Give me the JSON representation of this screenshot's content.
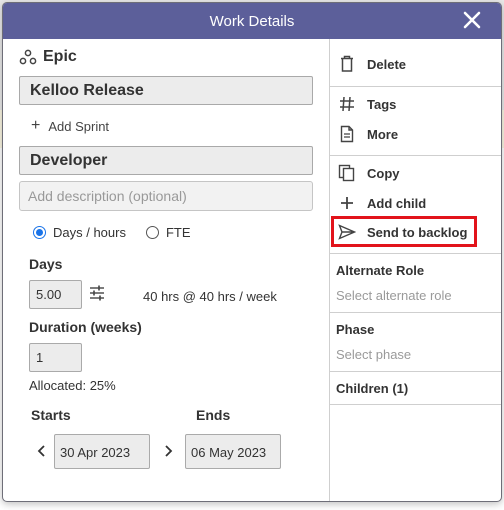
{
  "dialog": {
    "title": "Work Details",
    "type_label": "Epic",
    "parent_name": "Kelloo Release",
    "add_sprint_label": "Add Sprint",
    "role_name": "Developer",
    "description_placeholder": "Add description (optional)"
  },
  "units": {
    "options": [
      "Days / hours",
      "FTE"
    ],
    "selected": "Days / hours"
  },
  "days": {
    "label": "Days",
    "value": "5.00",
    "hours_note": "40 hrs @ 40 hrs / week"
  },
  "duration": {
    "label": "Duration (weeks)",
    "value": "1",
    "allocated": "Allocated: 25%"
  },
  "dates": {
    "starts_label": "Starts",
    "ends_label": "Ends",
    "start_value": "30 Apr 2023",
    "end_value": "06 May 2023"
  },
  "actions": {
    "delete": "Delete",
    "tags": "Tags",
    "more": "More",
    "copy": "Copy",
    "add_child": "Add child",
    "send_to_backlog": "Send to backlog"
  },
  "side": {
    "alternate_role_label": "Alternate Role",
    "alternate_role_placeholder": "Select alternate role",
    "phase_label": "Phase",
    "phase_placeholder": "Select phase",
    "children_label": "Children (1)"
  },
  "colors": {
    "titlebar": "#5c5f9a",
    "highlight": "#e2131b",
    "radio_selected": "#1a73e8"
  }
}
